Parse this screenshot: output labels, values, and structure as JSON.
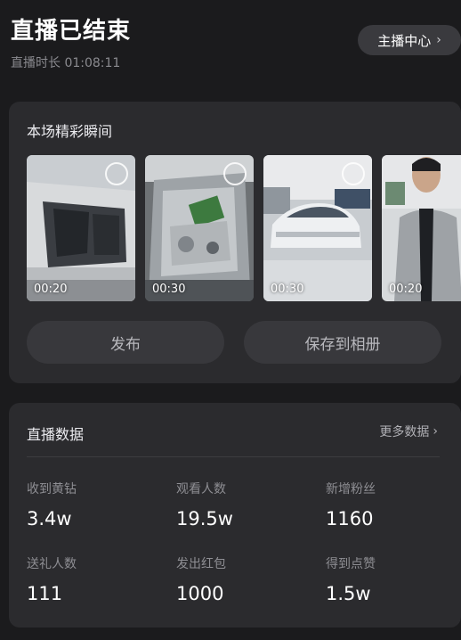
{
  "header": {
    "title": "直播已结束",
    "duration": "直播时长 01:08:11",
    "host_center_label": "主播中心"
  },
  "highlights": {
    "title": "本场精彩瞬间",
    "clips": [
      {
        "duration": "00:20"
      },
      {
        "duration": "00:30"
      },
      {
        "duration": "00:30"
      },
      {
        "duration": "00:20"
      }
    ],
    "publish_label": "发布",
    "save_label": "保存到相册"
  },
  "stats": {
    "title": "直播数据",
    "more_label": "更多数据",
    "metrics": [
      {
        "label": "收到黄钻",
        "value": "3.4w"
      },
      {
        "label": "观看人数",
        "value": "19.5w"
      },
      {
        "label": "新增粉丝",
        "value": "1160"
      },
      {
        "label": "送礼人数",
        "value": "111"
      },
      {
        "label": "发出红包",
        "value": "1000"
      },
      {
        "label": "得到点赞",
        "value": "1.5w"
      }
    ]
  }
}
